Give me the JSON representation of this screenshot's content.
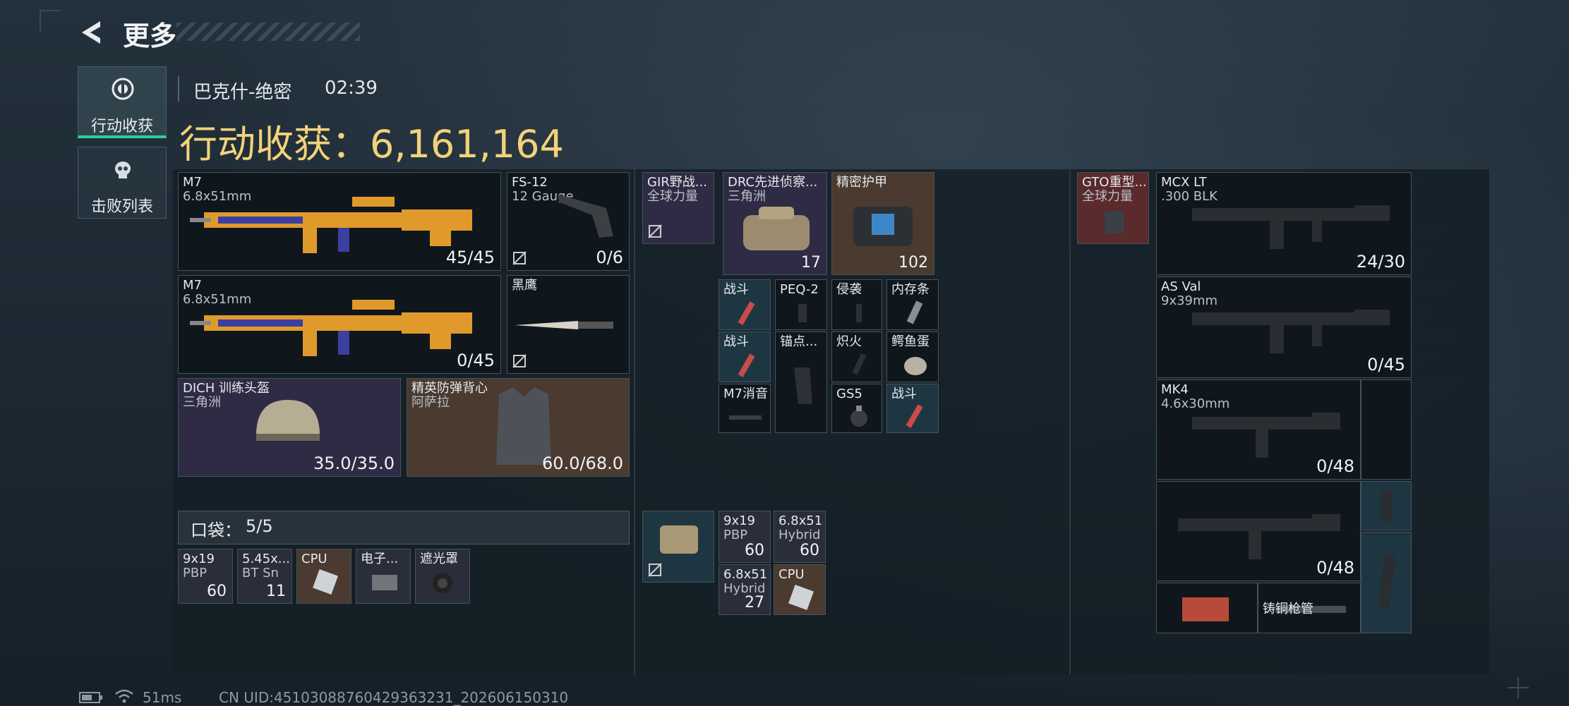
{
  "header": {
    "title": "更多",
    "map_name": "巴克什-绝密",
    "time": "02:39"
  },
  "tabs": [
    {
      "label": "行动收获",
      "active": true
    },
    {
      "label": "击败列表",
      "active": false
    }
  ],
  "total": {
    "label": "行动收获：",
    "value": "6,161,164"
  },
  "loadout": {
    "primary1": {
      "name": "M7",
      "sub": "6.8x51mm",
      "count": "45/45"
    },
    "sidearm": {
      "name": "FS-12",
      "sub": "12 Gauge",
      "count": "0/6"
    },
    "primary2": {
      "name": "M7",
      "sub": "6.8x51mm",
      "count": "0/45"
    },
    "melee": {
      "name": "黑鹰"
    },
    "helmet": {
      "name": "DICH 训练头盔",
      "sub": "三角洲",
      "count": "35.0/35.0"
    },
    "vest": {
      "name": "精英防弹背心",
      "sub": "阿萨拉",
      "count": "60.0/68.0"
    }
  },
  "pockets": {
    "label": "口袋：",
    "count": "5/5",
    "items": [
      {
        "name": "9x19",
        "sub": "PBP",
        "count": "60"
      },
      {
        "name": "5.45x...",
        "sub": "BT Sn",
        "count": "11"
      },
      {
        "name": "CPU",
        "sub": "",
        "count": ""
      },
      {
        "name": "电子...",
        "sub": "",
        "count": ""
      },
      {
        "name": "遮光罩",
        "sub": "",
        "count": ""
      }
    ]
  },
  "rig": {
    "item": {
      "name": "GIR野战...",
      "sub": "全球力量"
    },
    "slots": [
      {
        "name": "战斗"
      },
      {
        "name": "PEQ-2"
      },
      {
        "name": "侵袭"
      },
      {
        "name": "内存条"
      },
      {
        "name": "战斗"
      },
      {
        "name": "锚点..."
      },
      {
        "name": "炽火"
      },
      {
        "name": "鳄鱼蛋"
      },
      {
        "name": "M7消音"
      },
      {
        "name": ""
      },
      {
        "name": "GS5"
      },
      {
        "name": "战斗"
      }
    ]
  },
  "backpack": {
    "item": {
      "name": "DRC先进侦察...",
      "sub": "三角洲",
      "count": "17"
    },
    "armor": {
      "name": "精密护甲",
      "count": "102"
    }
  },
  "misc_items": [
    {
      "name": "9x19",
      "sub": "PBP",
      "count": "60"
    },
    {
      "name": "6.8x51",
      "sub": "Hybrid",
      "count": "60"
    },
    {
      "name": "6.8x51",
      "sub": "Hybrid",
      "count": "27"
    },
    {
      "name": "CPU",
      "sub": "",
      "count": ""
    }
  ],
  "safe_box": {
    "name": "GTO重型...",
    "sub": "全球力量"
  },
  "container_guns": [
    {
      "name": "MCX LT",
      "sub": ".300 BLK",
      "count": "24/30"
    },
    {
      "name": "AS Val",
      "sub": "9x39mm",
      "count": "0/45"
    },
    {
      "name": "MK4",
      "sub": "4.6x30mm",
      "count": "0/48"
    },
    {
      "name": "",
      "sub": "",
      "count": "0/48"
    }
  ],
  "container_misc": {
    "label": "铸铜枪管"
  },
  "status": {
    "ping": "51ms",
    "uid": "CN UID:4510308876042936323​1_202606150310"
  },
  "colors": {
    "accent": "#2fcf9a",
    "gold": "#f2d27a"
  }
}
